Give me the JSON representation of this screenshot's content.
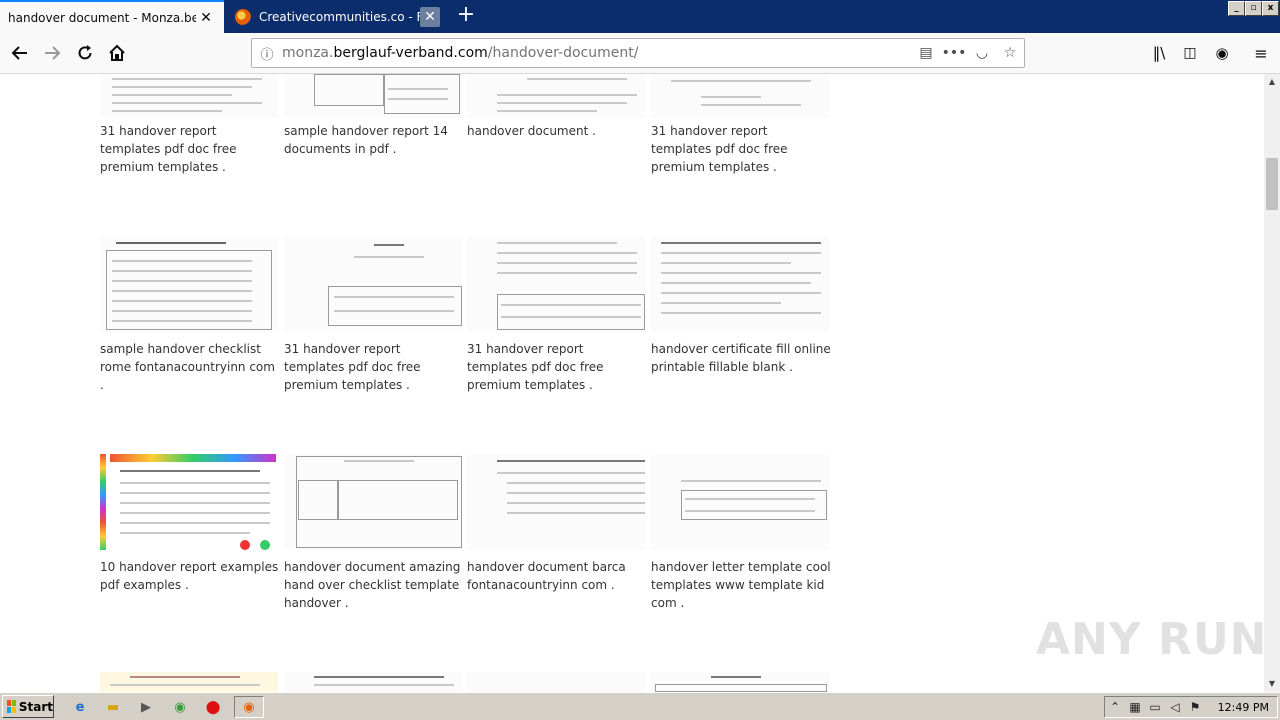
{
  "browser": {
    "tabs": [
      {
        "title": "handover document - Monza.berglauf-",
        "active": true
      },
      {
        "title": "Creativecommunities.co - Free All",
        "active": false
      }
    ],
    "new_tab_label": "+",
    "url": {
      "prefix": "monza.",
      "domain": "berglauf-verband.com",
      "path": "/handover-document/"
    },
    "window_controls": {
      "minimize": "_",
      "restore": "▫",
      "close": "x"
    }
  },
  "gallery": {
    "rows": [
      [
        "31 handover report templates pdf doc free premium templates .",
        "sample handover report 14 documents in pdf .",
        "handover document .",
        "31 handover report templates pdf doc free premium templates ."
      ],
      [
        "sample handover checklist rome fontanacountryinn com .",
        "31 handover report templates pdf doc free premium templates .",
        "31 handover report templates pdf doc free premium templates .",
        "handover certificate fill online printable fillable blank ."
      ],
      [
        "10 handover report examples pdf examples .",
        "handover document amazing hand over checklist template handover .",
        "handover document barca fontanacountryinn com .",
        "handover letter template cool templates www template kid com ."
      ]
    ]
  },
  "watermark": "ANY RUN",
  "taskbar": {
    "start_label": "Start",
    "clock": "12:49 PM"
  },
  "icons": {
    "back": "back-arrow-icon",
    "forward": "forward-arrow-icon",
    "reload": "reload-icon",
    "home": "home-icon"
  }
}
